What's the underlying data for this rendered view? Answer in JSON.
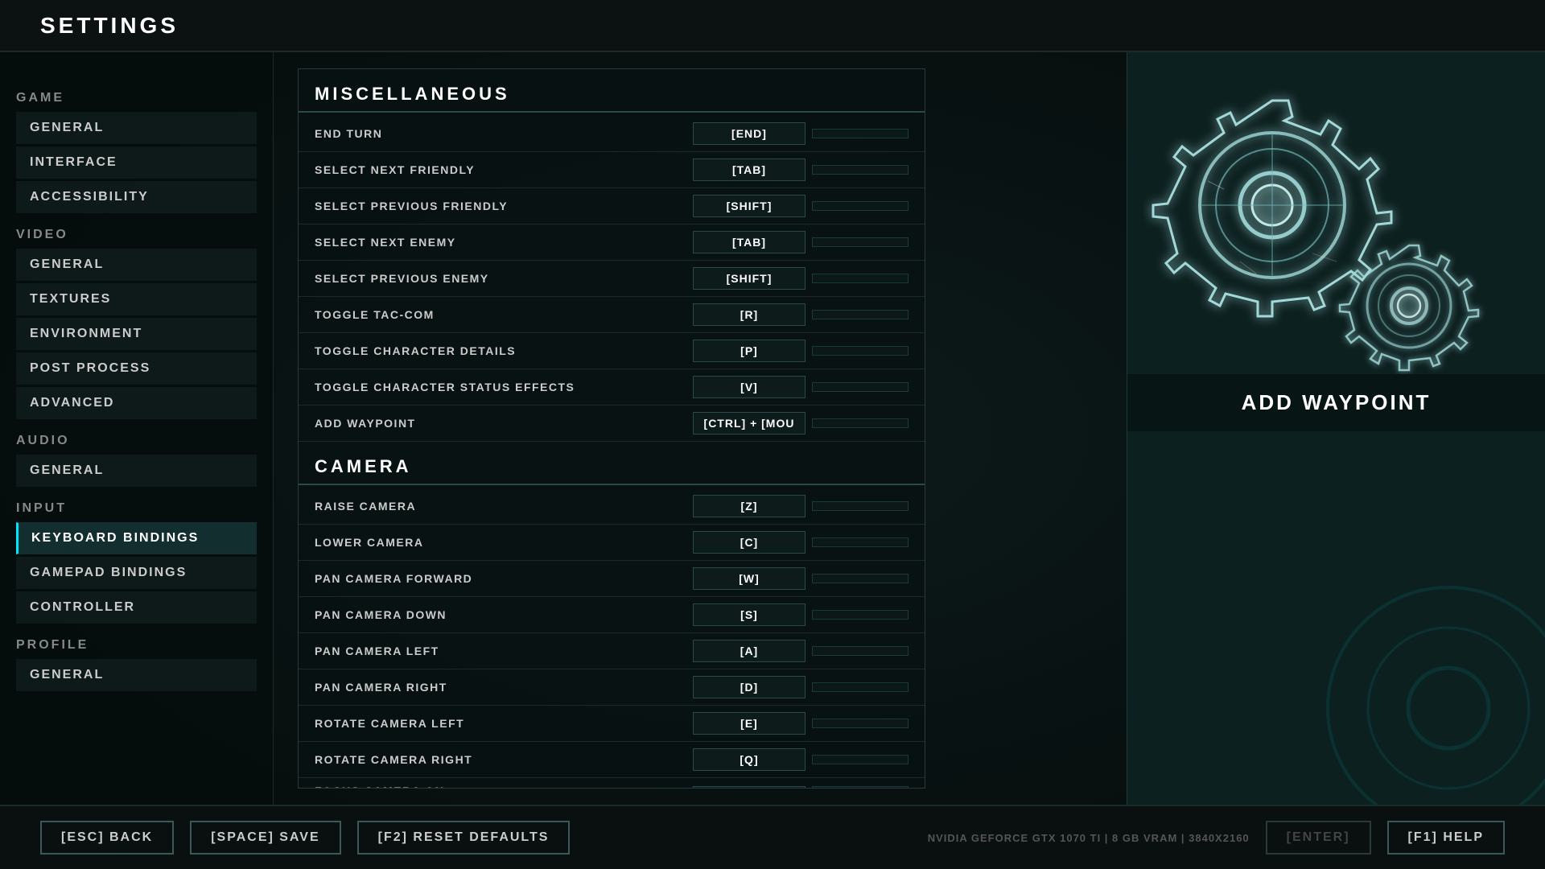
{
  "header": {
    "title": "SETTINGS"
  },
  "sidebar": {
    "game_label": "GAME",
    "video_label": "VIDEO",
    "audio_label": "AUDIO",
    "input_label": "INPUT",
    "profile_label": "PROFILE",
    "game_items": [
      "GENERAL",
      "INTERFACE",
      "ACCESSIBILITY"
    ],
    "video_items": [
      "GENERAL",
      "TEXTURES",
      "ENVIRONMENT",
      "POST PROCESS",
      "ADVANCED"
    ],
    "audio_items": [
      "GENERAL"
    ],
    "input_items": [
      "KEYBOARD BINDINGS",
      "GAMEPAD BINDINGS",
      "CONTROLLER"
    ],
    "profile_items": [
      "GENERAL"
    ]
  },
  "bindings": {
    "misc_header": "MISCELLANEOUS",
    "camera_header": "CAMERA",
    "misc_rows": [
      {
        "name": "END TURN",
        "key1": "[END]",
        "key2": ""
      },
      {
        "name": "SELECT NEXT FRIENDLY",
        "key1": "[TAB]",
        "key2": ""
      },
      {
        "name": "SELECT PREVIOUS FRIENDLY",
        "key1": "[SHIFT]",
        "key2": ""
      },
      {
        "name": "SELECT NEXT ENEMY",
        "key1": "[TAB]",
        "key2": ""
      },
      {
        "name": "SELECT PREVIOUS ENEMY",
        "key1": "[SHIFT]",
        "key2": ""
      },
      {
        "name": "TOGGLE TAC-COM",
        "key1": "[R]",
        "key2": ""
      },
      {
        "name": "TOGGLE CHARACTER DETAILS",
        "key1": "[P]",
        "key2": ""
      },
      {
        "name": "TOGGLE CHARACTER STATUS EFFECTS",
        "key1": "[V]",
        "key2": ""
      },
      {
        "name": "ADD WAYPOINT",
        "key1": "[CTRL] + [MOU",
        "key2": ""
      }
    ],
    "camera_rows": [
      {
        "name": "RAISE CAMERA",
        "key1": "[Z]",
        "key2": ""
      },
      {
        "name": "LOWER CAMERA",
        "key1": "[C]",
        "key2": ""
      },
      {
        "name": "PAN CAMERA FORWARD",
        "key1": "[W]",
        "key2": ""
      },
      {
        "name": "PAN CAMERA DOWN",
        "key1": "[S]",
        "key2": ""
      },
      {
        "name": "PAN CAMERA LEFT",
        "key1": "[A]",
        "key2": ""
      },
      {
        "name": "PAN CAMERA RIGHT",
        "key1": "[D]",
        "key2": ""
      },
      {
        "name": "ROTATE CAMERA LEFT",
        "key1": "[E]",
        "key2": ""
      },
      {
        "name": "ROTATE CAMERA RIGHT",
        "key1": "[Q]",
        "key2": ""
      },
      {
        "name": "FOCUS CAMERA ON",
        "key1": "",
        "key2": ""
      }
    ]
  },
  "right_panel": {
    "label": "ADD WAYPOINT"
  },
  "bottom_bar": {
    "back_btn": "[ESC] BACK",
    "save_btn": "[SPACE] SAVE",
    "reset_btn": "[F2] RESET DEFAULTS",
    "enter_btn": "[ENTER]",
    "help_btn": "[F1] HELP",
    "gpu_info": "NVIDIA GEFORCE GTX 1070 TI | 8 GB VRAM | 3840X2160"
  }
}
